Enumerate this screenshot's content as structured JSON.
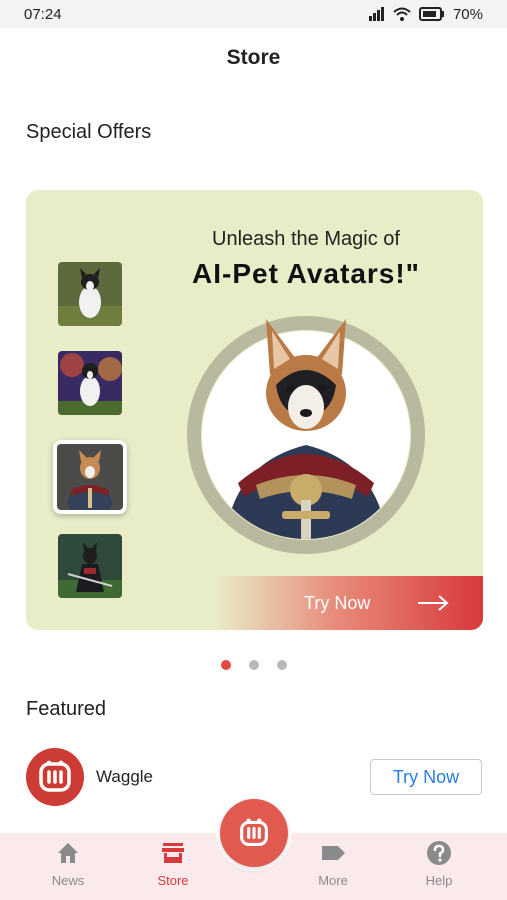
{
  "status_bar": {
    "time": "07:24",
    "battery": "70%"
  },
  "header": {
    "title": "Store"
  },
  "special_offers": {
    "title": "Special Offers",
    "banner": {
      "subtitle": "Unleash the Magic of",
      "headline": "AI-Pet Avatars!\"",
      "cta": "Try Now"
    },
    "carousel": {
      "pages": 3,
      "current_page": 1
    }
  },
  "featured": {
    "title": "Featured",
    "items": [
      {
        "name": "Waggle",
        "button": "Try Now"
      }
    ]
  },
  "bottom_nav": {
    "items": [
      {
        "label": "News",
        "icon": "home-icon"
      },
      {
        "label": "Store",
        "icon": "store-icon",
        "active": true
      },
      {
        "label": "More",
        "icon": "tag-icon"
      },
      {
        "label": "Help",
        "icon": "help-icon"
      }
    ]
  },
  "colors": {
    "accent": "#d8393a",
    "banner_bg": "#e8ecc7",
    "link": "#2a7de1",
    "nav_bg": "#faeaec"
  }
}
